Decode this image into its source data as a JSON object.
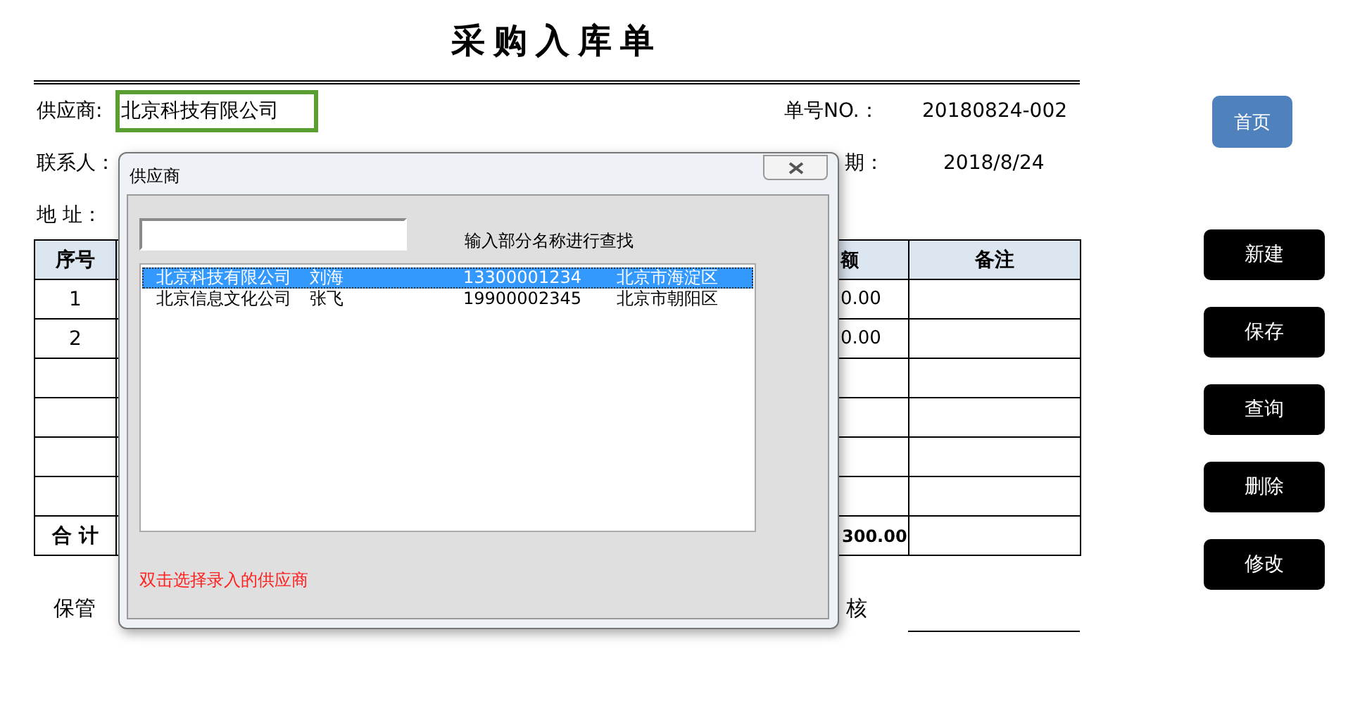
{
  "title": "采购入库单",
  "header": {
    "supplier_label": "供应商:",
    "supplier_value": "北京科技有限公司",
    "order_no_label": "单号NO.：",
    "order_no": "20180824-002",
    "contact_label": "联系人：",
    "date_label": "期：",
    "date": "2018/8/24",
    "address_label": "地 址："
  },
  "table": {
    "columns": {
      "seq": "序号",
      "amount": "额",
      "note": "备注"
    },
    "rows": [
      {
        "seq": "1",
        "amount": "0.00"
      },
      {
        "seq": "2",
        "amount": "0.00"
      },
      {},
      {},
      {},
      {}
    ],
    "total": {
      "label": "合 计",
      "amount": "300.00"
    }
  },
  "footer": {
    "keeper_label": "保管",
    "reviewer_label": "核"
  },
  "dialog": {
    "title": "供应商",
    "search_hint": "输入部分名称进行查找",
    "items": [
      {
        "name": "北京科技有限公司",
        "contact": "刘海",
        "phone": "13300001234",
        "address": "北京市海淀区",
        "selected": true
      },
      {
        "name": "北京信息文化公司",
        "contact": "张飞",
        "phone": "19900002345",
        "address": "北京市朝阳区",
        "selected": false
      }
    ],
    "note": "双击选择录入的供应商"
  },
  "nav": {
    "home": "首页",
    "actions": [
      "新建",
      "保存",
      "查询",
      "删除",
      "修改"
    ]
  }
}
